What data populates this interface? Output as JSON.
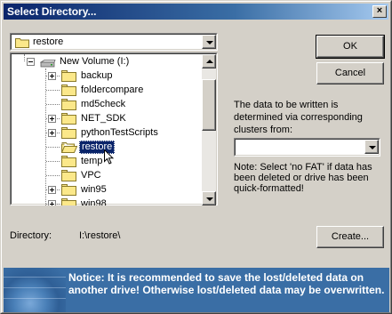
{
  "window": {
    "title": "Select Directory...",
    "close_glyph": "×"
  },
  "drive_combo": {
    "value": "restore",
    "icon": "folder-icon"
  },
  "tree": {
    "items": [
      {
        "label": "New Volume (I:)",
        "icon": "drive-icon",
        "expander": "minus"
      },
      {
        "label": "backup",
        "icon": "folder-icon",
        "expander": "plus"
      },
      {
        "label": "foldercompare",
        "icon": "folder-icon",
        "expander": ""
      },
      {
        "label": "md5check",
        "icon": "folder-icon",
        "expander": ""
      },
      {
        "label": "NET_SDK",
        "icon": "folder-icon",
        "expander": "plus"
      },
      {
        "label": "pythonTestScripts",
        "icon": "folder-icon",
        "expander": "plus"
      },
      {
        "label": "restore",
        "icon": "folder-icon",
        "expander": "",
        "selected": true
      },
      {
        "label": "temp",
        "icon": "folder-icon",
        "expander": ""
      },
      {
        "label": "VPC",
        "icon": "folder-icon",
        "expander": ""
      },
      {
        "label": "win95",
        "icon": "folder-icon",
        "expander": "plus"
      },
      {
        "label": "win98",
        "icon": "folder-icon",
        "expander": "plus"
      }
    ]
  },
  "buttons": {
    "ok": "OK",
    "cancel": "Cancel",
    "create": "Create..."
  },
  "info_text": "The data to be written is determined via corresponding clusters from:",
  "fat_combo": {
    "value": ""
  },
  "note_text": "Note: Select 'no FAT' if data has been deleted or drive has been quick-formatted!",
  "directory": {
    "label": "Directory:",
    "value": "I:\\restore\\"
  },
  "notice": "Notice: It is recommended to save the lost/deleted data on another drive! Otherwise lost/deleted data may be overwritten.",
  "colors": {
    "title_start": "#0a246a",
    "title_end": "#a6caf0",
    "selection": "#0a246a",
    "notice_bg": "#3a6ea5",
    "face": "#d4d0c8"
  }
}
